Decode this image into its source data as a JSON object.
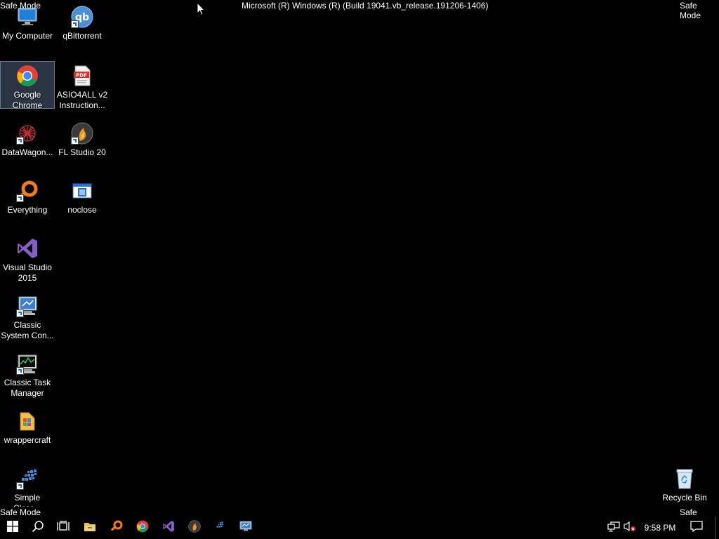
{
  "overlay": {
    "safe_mode": "Safe Mode",
    "build": "Microsoft (R) Windows (R) (Build 19041.vb_release.191206-1406)"
  },
  "desktop": {
    "icons": [
      {
        "label": "My Computer",
        "icon": "computer-icon"
      },
      {
        "label": "qBittorrent",
        "icon": "qbittorrent-icon"
      },
      {
        "label": "Google Chrome",
        "icon": "chrome-icon"
      },
      {
        "label": "ASIO4ALL v2 Instruction...",
        "icon": "pdf-icon"
      },
      {
        "label": "DataWagon...",
        "icon": "datawagon-icon"
      },
      {
        "label": "FL Studio 20",
        "icon": "fl-studio-icon"
      },
      {
        "label": "Everything",
        "icon": "everything-icon"
      },
      {
        "label": "noclose",
        "icon": "window-icon"
      },
      {
        "label": "Visual Studio 2015",
        "icon": "visual-studio-icon"
      },
      {
        "label": "Classic System Con...",
        "icon": "control-panel-icon"
      },
      {
        "label": "Classic Task Manager",
        "icon": "task-manager-icon"
      },
      {
        "label": "wrappercraft",
        "icon": "wrappercraft-icon"
      },
      {
        "label": "Simple Class...",
        "icon": "simple-class-icon"
      },
      {
        "label": "Recycle Bin",
        "icon": "recycle-bin-icon"
      }
    ]
  },
  "taskbar": {
    "clock": "9:58 PM",
    "buttons": [
      "start-icon",
      "search-icon",
      "task-view-icon",
      "file-explorer-icon",
      "everything-icon",
      "chrome-icon",
      "visual-studio-icon",
      "fl-studio-icon",
      "datawagon-icon",
      "remote-desktop-icon"
    ],
    "tray": [
      "network-icon",
      "volume-muted-icon",
      "notification-icon"
    ]
  },
  "colors": {
    "background": "#000000",
    "selection": "#7896be",
    "accent": "#1e6ed6"
  }
}
